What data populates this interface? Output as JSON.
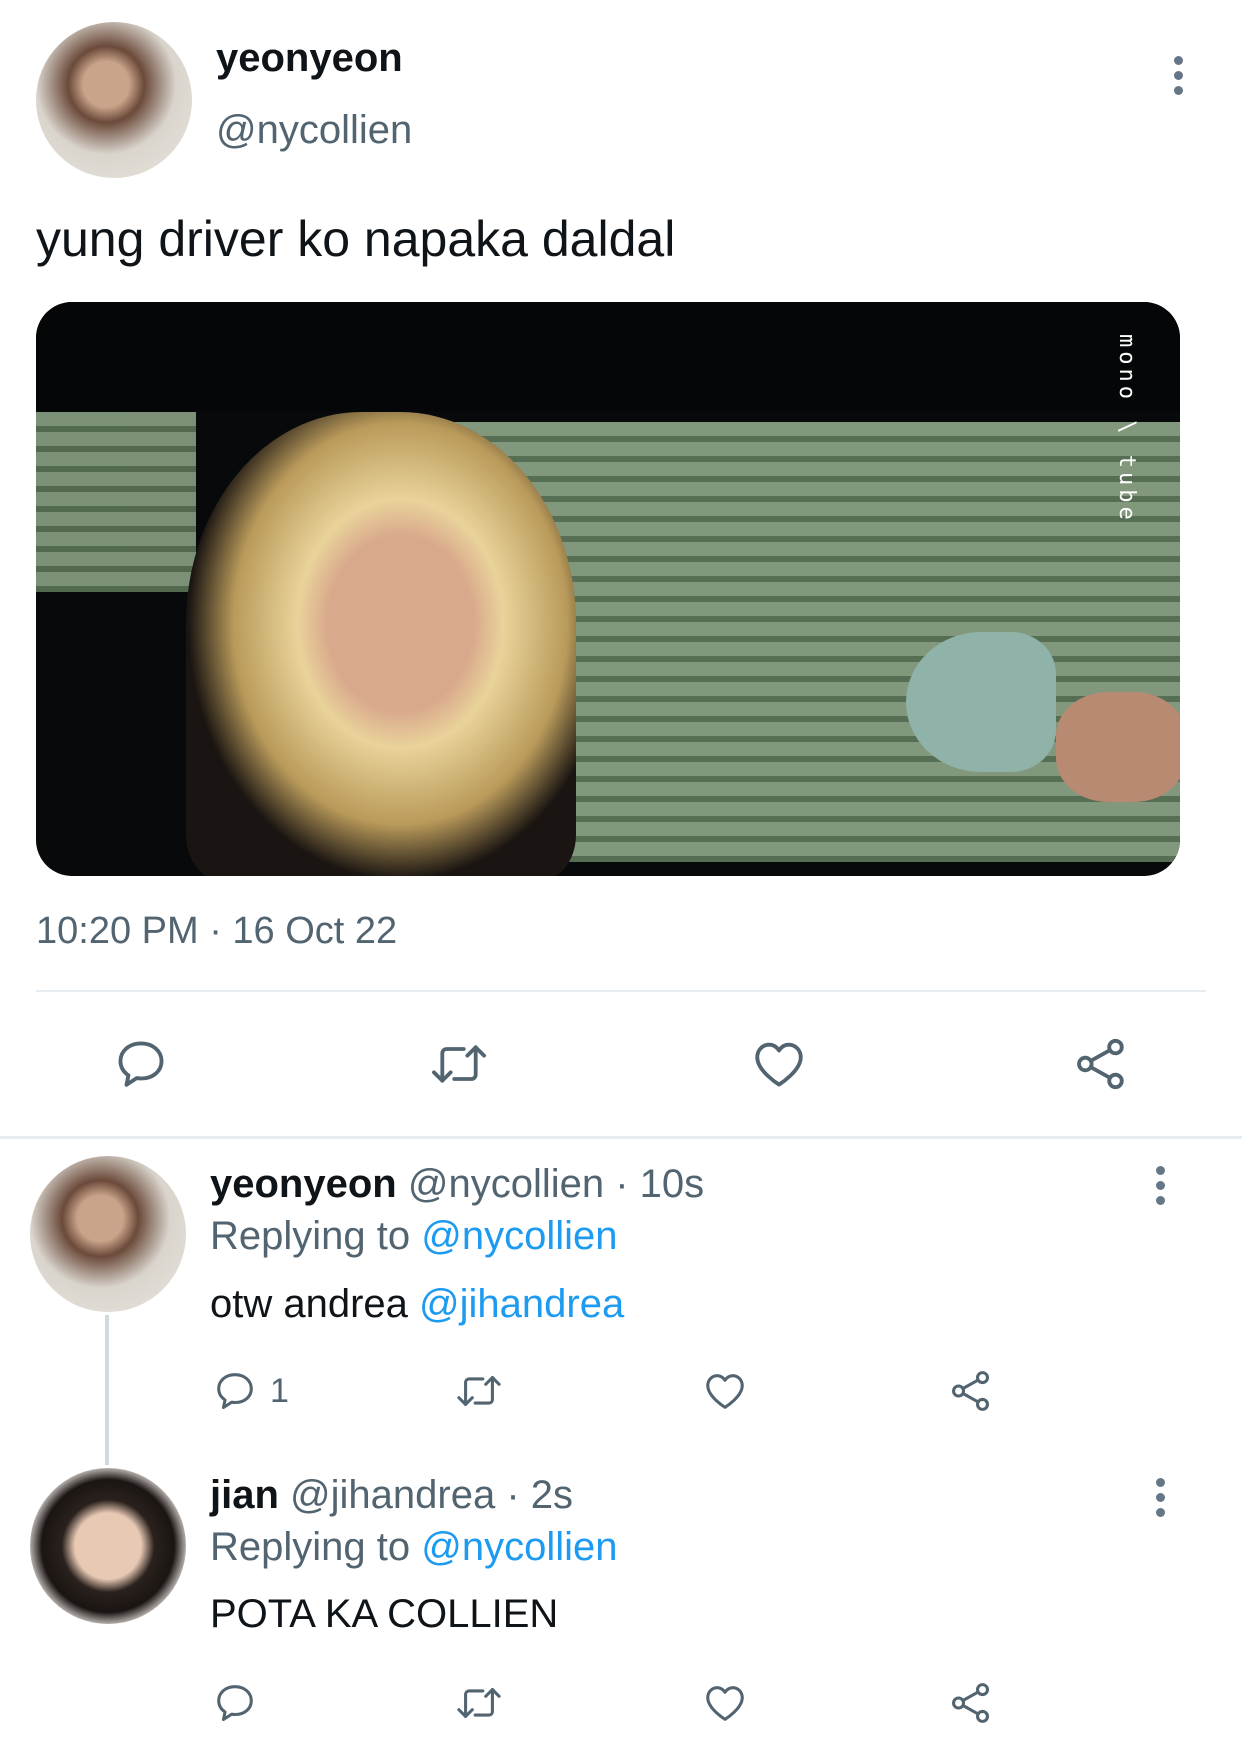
{
  "tweet": {
    "display_name": "yeonyeon",
    "handle": "@nycollien",
    "text": "yung driver ko napaka daldal",
    "media_watermark": "mono \\ tube",
    "timestamp": "10:20 PM · 16 Oct 22"
  },
  "replies": [
    {
      "display_name": "yeonyeon",
      "handle": "@nycollien",
      "time": "· 10s",
      "replying_label": "Replying to",
      "replying_handle": "@nycollien",
      "text_prefix": "otw andrea",
      "mention": "@jihandrea",
      "reply_count": "1"
    },
    {
      "display_name": "jian",
      "handle": "@jihandrea",
      "time": "· 2s",
      "replying_label": "Replying to",
      "replying_handle": "@nycollien",
      "text": "POTA KA COLLIEN"
    }
  ],
  "icons": [
    "more-icon",
    "reply-icon",
    "retweet-icon",
    "like-icon",
    "share-icon"
  ],
  "colors": {
    "link": "#1d9bf0",
    "muted": "#536471",
    "icon": "#536471",
    "divider": "#e6ecf0"
  }
}
